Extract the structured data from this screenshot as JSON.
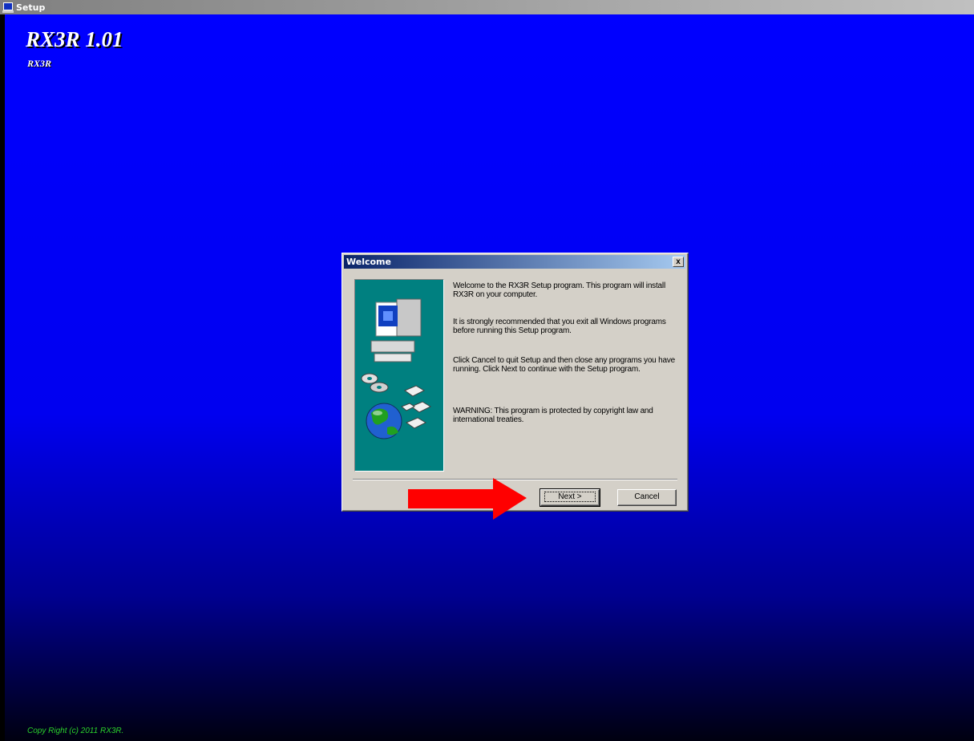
{
  "window": {
    "title": "Setup"
  },
  "installer": {
    "title": "RX3R 1.01",
    "subtitle": "RX3R",
    "copyright": "Copy Right (c) 2011 RX3R."
  },
  "dialog": {
    "title": "Welcome",
    "close_label": "x",
    "messages": [
      "Welcome to the RX3R Setup program. This program will install RX3R on your computer.",
      "It is strongly recommended that you exit all Windows programs before running this Setup program.",
      "Click Cancel to quit Setup and then close any programs you have running. Click Next to continue with the Setup program.",
      "WARNING: This program is protected by copyright law and international treaties."
    ],
    "next_label": "Next >",
    "cancel_label": "Cancel"
  },
  "colors": {
    "desktop": "#0000ff",
    "dialog_face": "#d4d0c8",
    "side_panel": "#008080",
    "annotation_arrow": "#ff0000",
    "copyright_text": "#2bd22b"
  },
  "icons": [
    "setup-app-icon",
    "close-icon",
    "computer-icon",
    "cd-icon",
    "globe-icon",
    "disk-icon",
    "red-arrow-icon"
  ]
}
